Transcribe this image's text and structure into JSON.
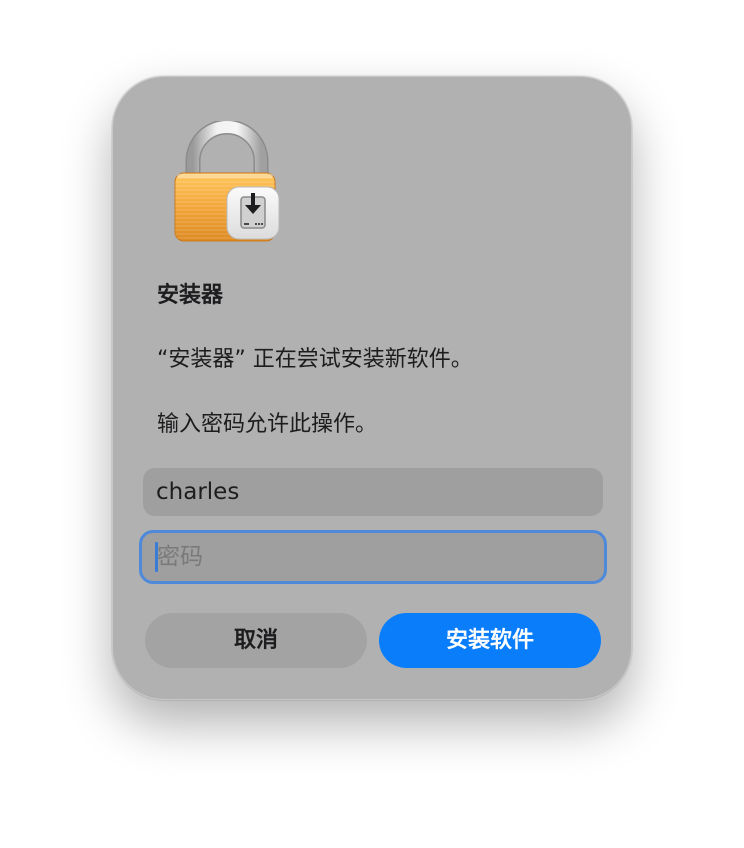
{
  "dialog": {
    "app_name": "安装器",
    "message": "“安装器” 正在尝试安装新软件。",
    "prompt": "输入密码允许此操作。",
    "username": "charles",
    "password_placeholder": "密码",
    "cancel_label": "取消",
    "confirm_label": "安装软件",
    "icons": {
      "lock": "padlock-icon",
      "badge": "installer-download-icon"
    },
    "colors": {
      "dialog_bg": "#b1b1b1",
      "primary_button": "#0a7dfb",
      "focus_ring": "#4f89da",
      "lock_body": "#f0a434",
      "lock_shackle": "#d6d6d6"
    }
  }
}
